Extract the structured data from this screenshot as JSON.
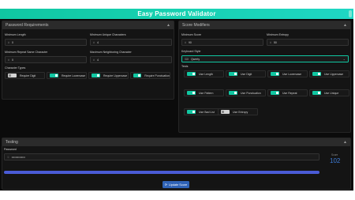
{
  "app": {
    "title": "Easy Password Validator"
  },
  "colors": {
    "accent": "#10c7a2",
    "button": "#2f63b7",
    "progress": "#4a5bd6"
  },
  "requirements": {
    "title": "Password Requirements",
    "min_length": {
      "label": "Minimum Length",
      "value": "0"
    },
    "min_unique": {
      "label": "Minimum Unique Characters",
      "value": "4"
    },
    "max_repeat": {
      "label": "Minimum Repeat Same Character",
      "value": "0"
    },
    "max_neighbor": {
      "label": "Maximum Neighboring Character",
      "value": "4"
    },
    "char_types_label": "Character Types",
    "char_types": [
      {
        "label": "Require Digit",
        "on": false
      },
      {
        "label": "Require Lowercase",
        "on": true
      },
      {
        "label": "Require Uppercase",
        "on": true
      },
      {
        "label": "Require Punctuation",
        "on": true
      }
    ]
  },
  "modifiers": {
    "title": "Score Modifiers",
    "min_score": {
      "label": "Minimum Score",
      "value": "90"
    },
    "min_entropy": {
      "label": "Minimum Entropy",
      "value": "50"
    },
    "keyboard_style": {
      "label": "Keyboard Style",
      "value": "Qwerty"
    },
    "tests_label": "Tests",
    "tests": [
      {
        "label": "Use Length",
        "on": true
      },
      {
        "label": "Use Digit",
        "on": true
      },
      {
        "label": "Use Lowercase",
        "on": true
      },
      {
        "label": "Use Uppercase",
        "on": true
      },
      {
        "label": "Use Pattern",
        "on": true
      },
      {
        "label": "Use Punctuation",
        "on": true
      },
      {
        "label": "Use Repeat",
        "on": true
      },
      {
        "label": "Use Unique",
        "on": true
      },
      {
        "label": "Use Bad List",
        "on": true
      },
      {
        "label": "Use Entropy",
        "on": false
      }
    ]
  },
  "testing": {
    "title": "Testing",
    "password_label": "Password",
    "password_value": "••••••••••••••",
    "score_label": "Score",
    "score_value": "102",
    "progress": 1.0,
    "update_button": "Update Score"
  }
}
